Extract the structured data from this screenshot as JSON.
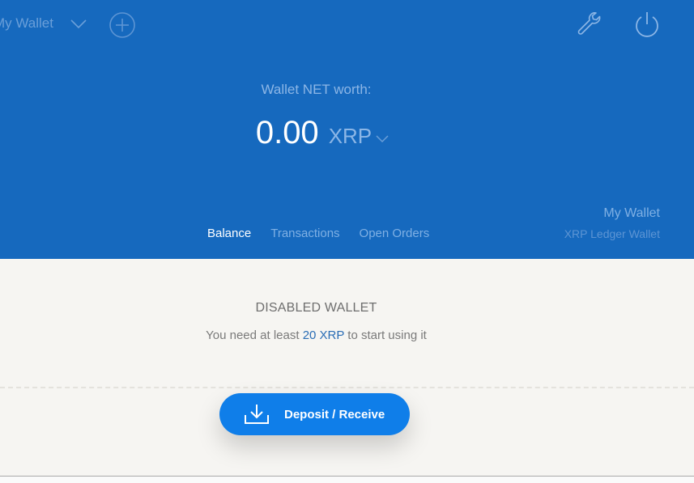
{
  "header": {
    "wallet_switcher_label": "My Wallet",
    "icons": {
      "switcher": "chevron-down-icon",
      "add": "plus-circle-icon",
      "settings": "wrench-icon",
      "power": "power-icon"
    },
    "net_worth_label": "Wallet NET worth:",
    "net_worth_amount": "0.00",
    "net_worth_currency": "XRP",
    "tabs": [
      {
        "label": "Balance",
        "active": true
      },
      {
        "label": "Transactions",
        "active": false
      },
      {
        "label": "Open Orders",
        "active": false
      }
    ],
    "wallet_name": "My Wallet",
    "wallet_type": "XRP Ledger Wallet"
  },
  "main": {
    "disabled_title": "DISABLED WALLET",
    "disabled_msg_prefix": "You need at least ",
    "disabled_msg_highlight": "20 XRP",
    "disabled_msg_suffix": " to start using it",
    "deposit_button_label": "Deposit / Receive",
    "deposit_icon": "download-icon"
  },
  "colors": {
    "header_bg": "#1669be",
    "page_bg": "#f6f5f2",
    "accent": "#0f7ee9",
    "link": "#2a6db5"
  }
}
